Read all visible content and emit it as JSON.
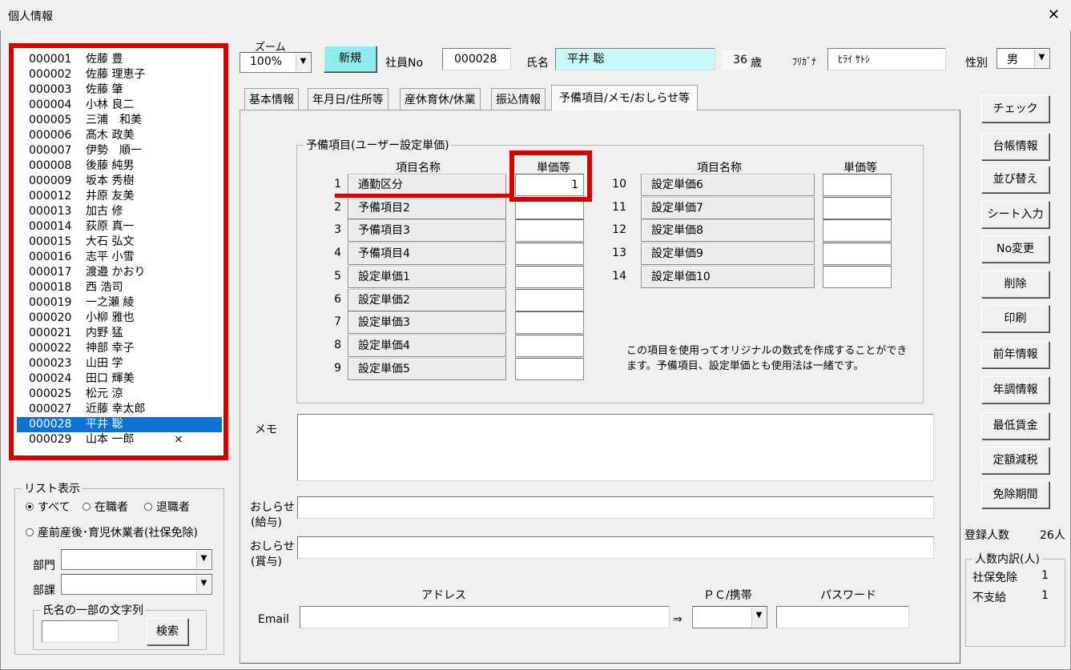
{
  "window": {
    "title": "個人情報",
    "close": "✕"
  },
  "employees": [
    {
      "no": "000001",
      "name": "佐藤 豊",
      "mark": ""
    },
    {
      "no": "000002",
      "name": "佐藤 理恵子",
      "mark": ""
    },
    {
      "no": "000003",
      "name": "佐藤 肇",
      "mark": ""
    },
    {
      "no": "000004",
      "name": "小林 良二",
      "mark": ""
    },
    {
      "no": "000005",
      "name": "三浦　和美",
      "mark": ""
    },
    {
      "no": "000006",
      "name": "髙木 政美",
      "mark": ""
    },
    {
      "no": "000007",
      "name": "伊勢　順一",
      "mark": ""
    },
    {
      "no": "000008",
      "name": "後藤 純男",
      "mark": ""
    },
    {
      "no": "000009",
      "name": "坂本 秀樹",
      "mark": ""
    },
    {
      "no": "000012",
      "name": "井原 友美",
      "mark": ""
    },
    {
      "no": "000013",
      "name": "加古 修",
      "mark": ""
    },
    {
      "no": "000014",
      "name": "荻原 真一",
      "mark": ""
    },
    {
      "no": "000015",
      "name": "大石 弘文",
      "mark": ""
    },
    {
      "no": "000016",
      "name": "志平 小雪",
      "mark": ""
    },
    {
      "no": "000017",
      "name": "渡邉 かおり",
      "mark": ""
    },
    {
      "no": "000018",
      "name": "西 浩司",
      "mark": ""
    },
    {
      "no": "000019",
      "name": "一之瀬 綾",
      "mark": ""
    },
    {
      "no": "000020",
      "name": "小柳 雅也",
      "mark": ""
    },
    {
      "no": "000021",
      "name": "内野 猛",
      "mark": ""
    },
    {
      "no": "000022",
      "name": "神部 幸子",
      "mark": ""
    },
    {
      "no": "000023",
      "name": "山田 学",
      "mark": ""
    },
    {
      "no": "000024",
      "name": "田口 輝美",
      "mark": ""
    },
    {
      "no": "000025",
      "name": "松元 涼",
      "mark": ""
    },
    {
      "no": "000027",
      "name": "近藤 幸太郎",
      "mark": ""
    },
    {
      "no": "000028",
      "name": "平井 聡",
      "mark": ""
    },
    {
      "no": "000029",
      "name": "山本 一郎",
      "mark": "×"
    }
  ],
  "selected_employee": "000028",
  "list_display": {
    "legend": "リスト表示",
    "opt_all": "すべて",
    "opt_active": "在職者",
    "opt_retired": "退職者",
    "opt_leave": "産前産後･育児休業者(社保免除)",
    "selected": "すべて",
    "dept_label": "部門",
    "dept_value": "",
    "section_label": "部課",
    "section_value": "",
    "name_search_legend": "氏名の一部の文字列",
    "name_search_value": "",
    "search_button": "検索"
  },
  "header": {
    "zoom_label": "ズーム",
    "zoom_value": "100%",
    "new_button": "新規",
    "empno_label": "社員No",
    "empno_value": "000028",
    "name_label": "氏名",
    "name_value": "平井 聡",
    "age_value": "36",
    "age_unit": "歳",
    "furigana_label": "ﾌﾘｶﾞﾅ",
    "furigana_value": "ﾋﾗｲ ｻﾄｼ",
    "gender_label": "性別",
    "gender_value": "男"
  },
  "tabs": [
    "基本情報",
    "年月日/住所等",
    "産休育休/休業",
    "振込情報",
    "予備項目/メモ/おしらせ等"
  ],
  "active_tab": "予備項目/メモ/おしらせ等",
  "reserve": {
    "legend": "予備項目(ユーザー設定単価)",
    "col_name": "項目名称",
    "col_price": "単価等",
    "left_rows": [
      {
        "num": "1",
        "name": "通勤区分",
        "value": "1"
      },
      {
        "num": "2",
        "name": "予備項目2",
        "value": ""
      },
      {
        "num": "3",
        "name": "予備項目3",
        "value": ""
      },
      {
        "num": "4",
        "name": "予備項目4",
        "value": ""
      },
      {
        "num": "5",
        "name": "設定単価1",
        "value": ""
      },
      {
        "num": "6",
        "name": "設定単価2",
        "value": ""
      },
      {
        "num": "7",
        "name": "設定単価3",
        "value": ""
      },
      {
        "num": "8",
        "name": "設定単価4",
        "value": ""
      },
      {
        "num": "9",
        "name": "設定単価5",
        "value": ""
      }
    ],
    "right_rows": [
      {
        "num": "10",
        "name": "設定単価6",
        "value": ""
      },
      {
        "num": "11",
        "name": "設定単価7",
        "value": ""
      },
      {
        "num": "12",
        "name": "設定単価8",
        "value": ""
      },
      {
        "num": "13",
        "name": "設定単価9",
        "value": ""
      },
      {
        "num": "14",
        "name": "設定単価10",
        "value": ""
      }
    ],
    "note_line1": "この項目を使用ってオリジナルの数式を作成することができ",
    "note_line2": "ます。予備項目、設定単価とも使用法は一緒です。"
  },
  "memo": {
    "label": "メモ",
    "value": ""
  },
  "notice_salary": {
    "label1": "おしらせ",
    "label2": "(給与)",
    "value": ""
  },
  "notice_bonus": {
    "label1": "おしらせ",
    "label2": "(賞与)",
    "value": ""
  },
  "email": {
    "label": "Email",
    "address_header": "アドレス",
    "address_value": "",
    "arrow": "⇒",
    "device_header": "ＰＣ/携帯",
    "device_value": "",
    "password_header": "パスワード",
    "password_value": ""
  },
  "side_buttons": [
    "チェック",
    "台帳情報",
    "並び替え",
    "シート入力",
    "No変更",
    "削除",
    "印刷",
    "前年情報",
    "年調情報",
    "最低賃金",
    "定額減税",
    "免除期間"
  ],
  "registration": {
    "label": "登録人数",
    "value": "26人"
  },
  "breakdown": {
    "legend": "人数内訳(人)",
    "exempt_label": "社保免除",
    "exempt_value": "1",
    "unpaid_label": "不支給",
    "unpaid_value": "1"
  },
  "colors": {
    "highlight_red": "#d60000",
    "selection_blue": "#0a74d4",
    "name_field_cyan": "#c8f8f8",
    "new_button_cyan": "#90ecec"
  }
}
